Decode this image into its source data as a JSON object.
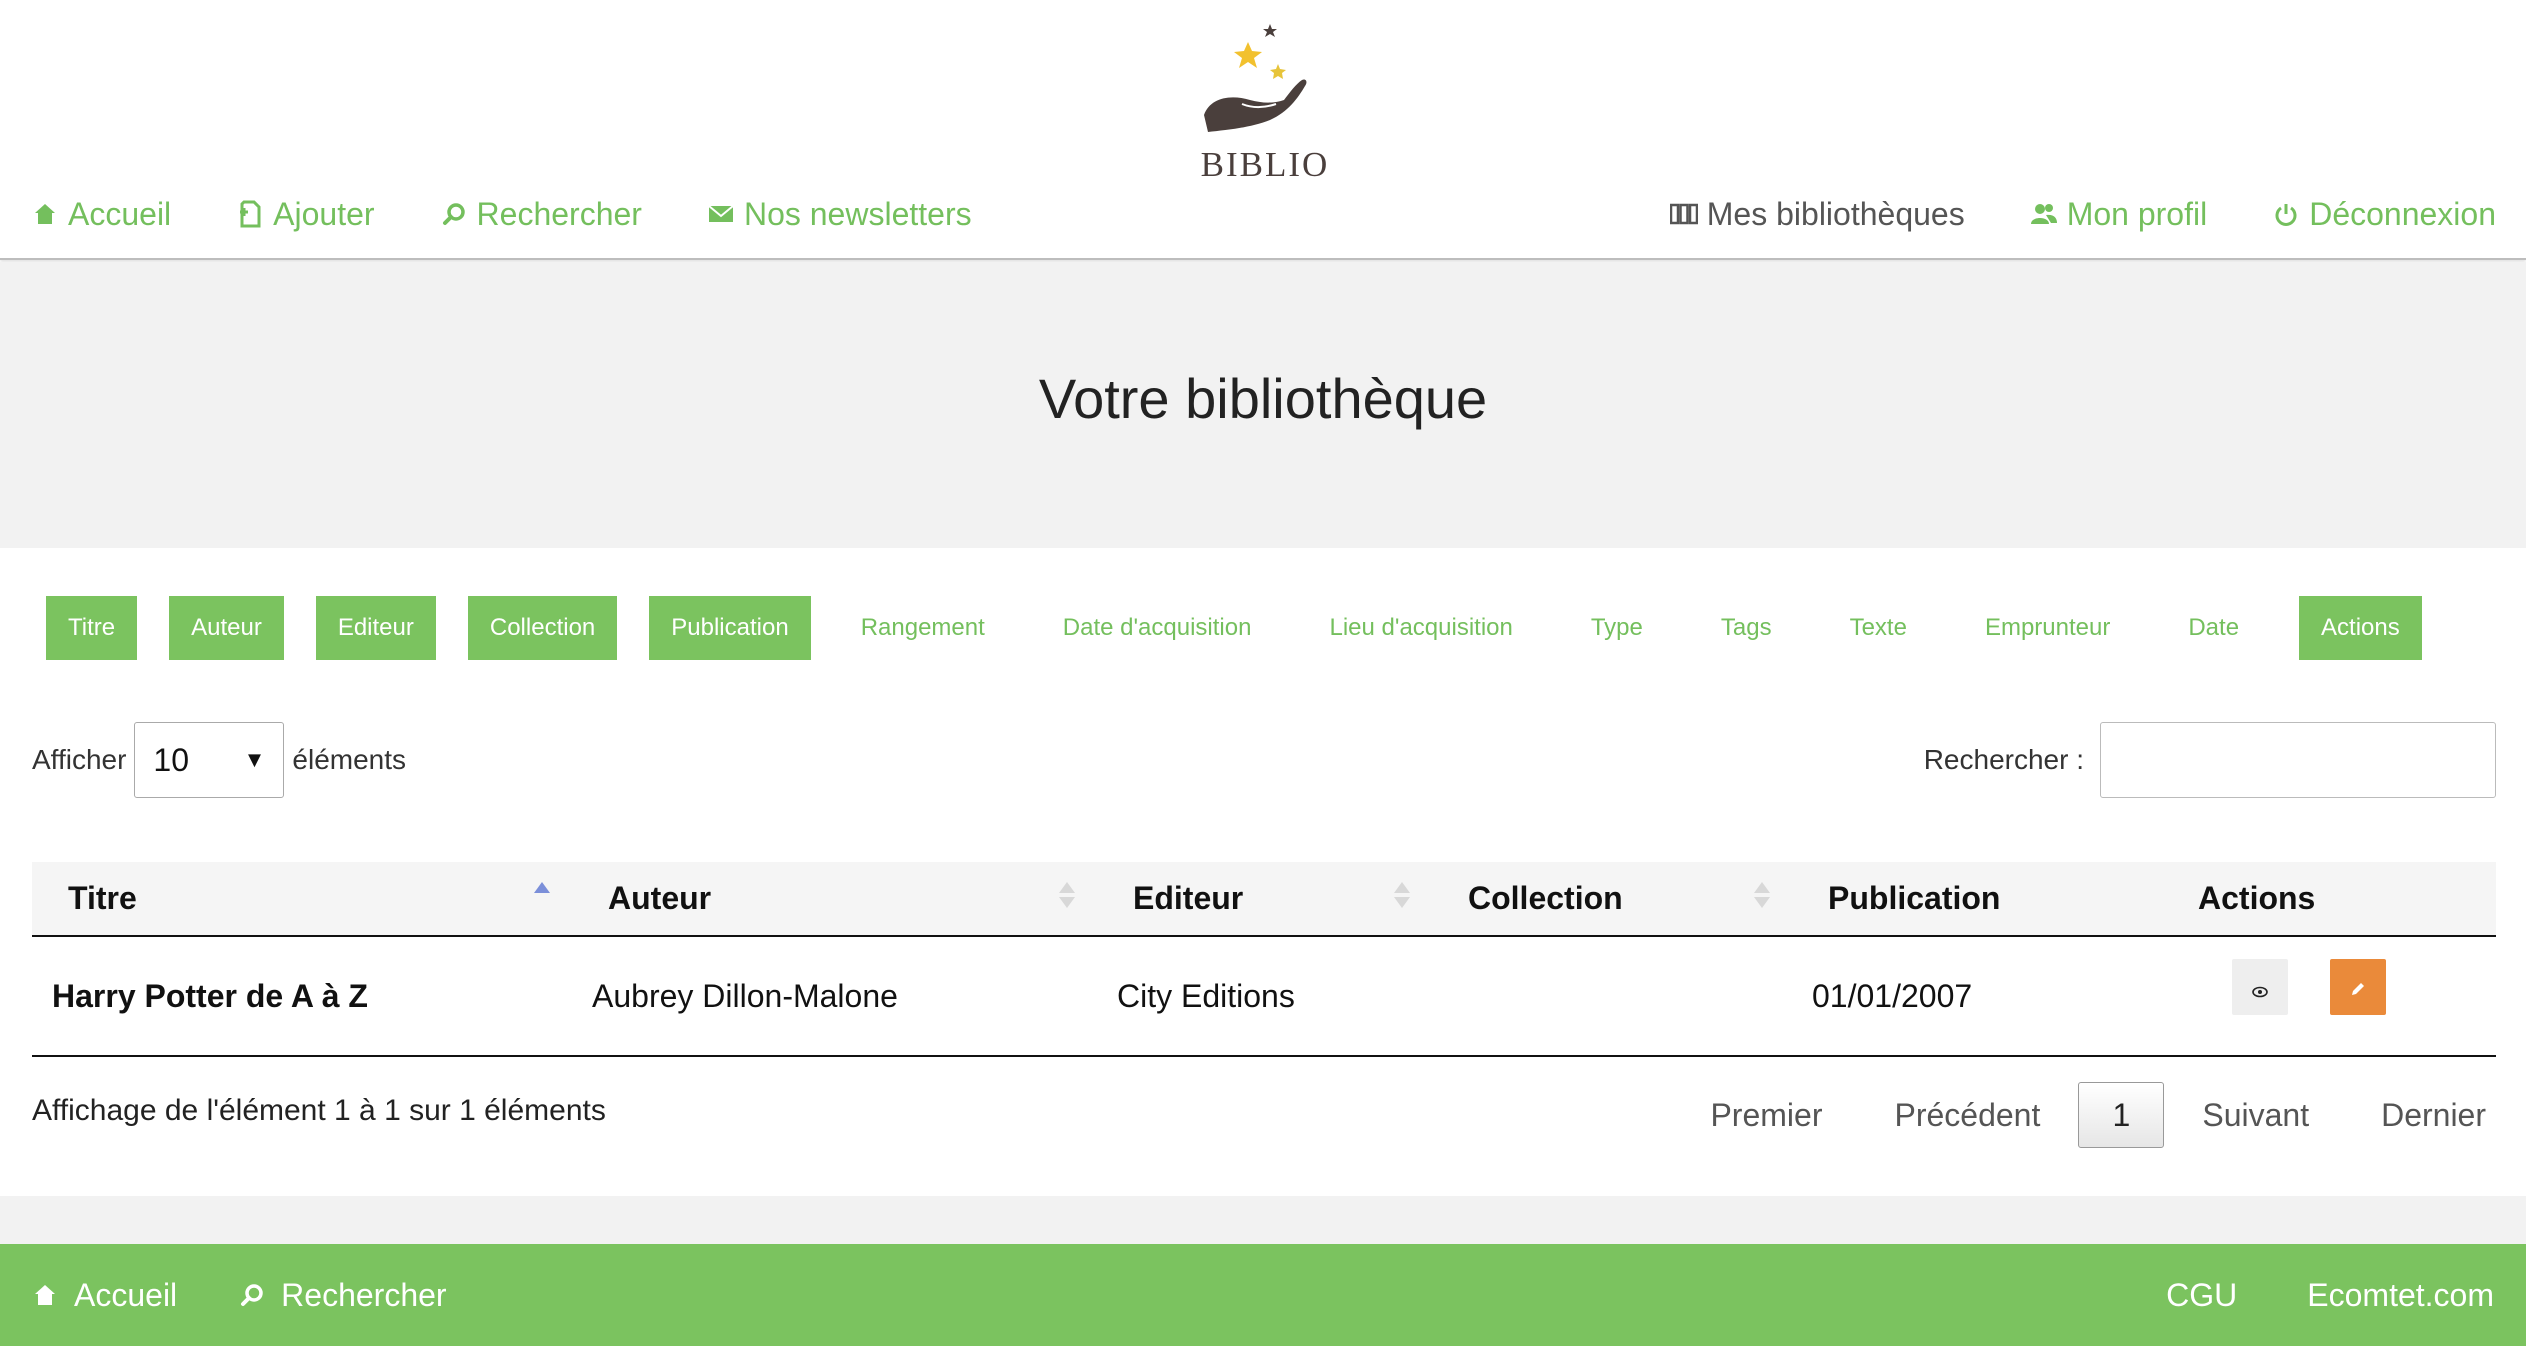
{
  "header": {
    "logo_text": "BIBLIO",
    "nav_left": [
      {
        "label": "Accueil",
        "icon": "home-icon"
      },
      {
        "label": "Ajouter",
        "icon": "add-document-icon"
      },
      {
        "label": "Rechercher",
        "icon": "search-icon"
      },
      {
        "label": "Nos newsletters",
        "icon": "mail-icon"
      }
    ],
    "nav_right": [
      {
        "label": "Mes bibliothèques",
        "icon": "books-icon"
      },
      {
        "label": "Mon profil",
        "icon": "users-icon"
      },
      {
        "label": "Déconnexion",
        "icon": "power-icon"
      }
    ]
  },
  "banner": {
    "title": "Votre bibliothèque"
  },
  "column_toggles": [
    {
      "label": "Titre",
      "active": true
    },
    {
      "label": "Auteur",
      "active": true
    },
    {
      "label": "Editeur",
      "active": true
    },
    {
      "label": "Collection",
      "active": true
    },
    {
      "label": "Publication",
      "active": true
    },
    {
      "label": "Rangement",
      "active": false
    },
    {
      "label": "Date d'acquisition",
      "active": false
    },
    {
      "label": "Lieu d'acquisition",
      "active": false
    },
    {
      "label": "Type",
      "active": false
    },
    {
      "label": "Tags",
      "active": false
    },
    {
      "label": "Texte",
      "active": false
    },
    {
      "label": "Emprunteur",
      "active": false
    },
    {
      "label": "Date",
      "active": false
    },
    {
      "label": "Actions",
      "active": true
    }
  ],
  "length": {
    "prefix": "Afficher",
    "value": "10",
    "suffix": "éléments"
  },
  "search": {
    "label": "Rechercher :",
    "value": ""
  },
  "table": {
    "headers": [
      "Titre",
      "Auteur",
      "Editeur",
      "Collection",
      "Publication",
      "Actions"
    ],
    "rows": [
      {
        "titre": "Harry Potter de A à Z",
        "auteur": "Aubrey Dillon-Malone",
        "editeur": "City Editions",
        "collection": "",
        "publication": "01/01/2007"
      }
    ]
  },
  "info": "Affichage de l'élément 1 à 1 sur 1 éléments",
  "pagination": {
    "first": "Premier",
    "previous": "Précédent",
    "current": "1",
    "next": "Suivant",
    "last": "Dernier"
  },
  "footer": {
    "left": [
      {
        "label": "Accueil",
        "icon": "home-icon"
      },
      {
        "label": "Rechercher",
        "icon": "search-icon"
      }
    ],
    "right": [
      "CGU",
      "Ecomtet.com"
    ]
  },
  "colors": {
    "accent_green": "#7bc35f",
    "edit_orange": "#ea8a3a",
    "banner_gray": "#f2f2f2"
  }
}
